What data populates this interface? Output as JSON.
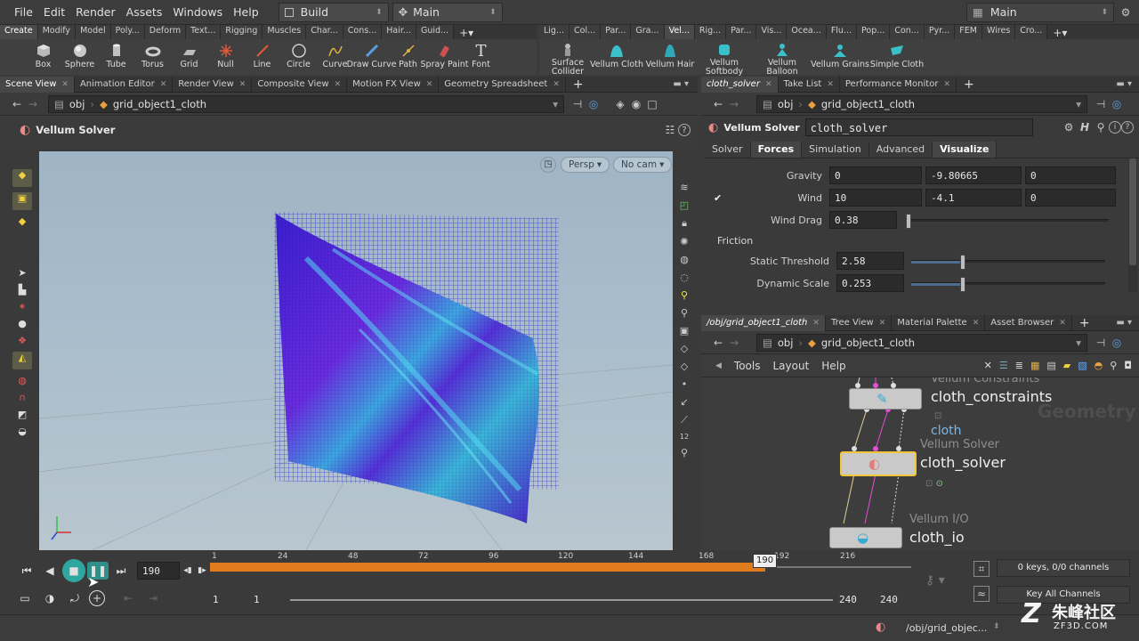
{
  "menubar": {
    "items": [
      "File",
      "Edit",
      "Render",
      "Assets",
      "Windows",
      "Help"
    ],
    "build_label": "Build",
    "desktop_label": "Main",
    "right_desktop_label": "Main"
  },
  "shelf": {
    "tabs_left": [
      "Create",
      "Modify",
      "Model",
      "Poly...",
      "Deform",
      "Text...",
      "Rigging",
      "Muscles",
      "Char...",
      "Cons...",
      "Hair...",
      "Guid..."
    ],
    "tabs_right": [
      "Lig...",
      "Col...",
      "Par...",
      "Gra...",
      "Vel...",
      "Rig...",
      "Par...",
      "Vis...",
      "Ocea...",
      "Flu...",
      "Pop...",
      "Con...",
      "Pyr...",
      "FEM",
      "Wires",
      "Cro..."
    ],
    "tools_left": [
      {
        "label": "Box",
        "icon": "box-icon"
      },
      {
        "label": "Sphere",
        "icon": "sphere-icon"
      },
      {
        "label": "Tube",
        "icon": "tube-icon"
      },
      {
        "label": "Torus",
        "icon": "torus-icon"
      },
      {
        "label": "Grid",
        "icon": "grid-icon"
      },
      {
        "label": "Null",
        "icon": "null-icon"
      },
      {
        "label": "Line",
        "icon": "line-icon"
      },
      {
        "label": "Circle",
        "icon": "circle-icon"
      },
      {
        "label": "Curve",
        "icon": "curve-icon"
      },
      {
        "label": "Draw Curve",
        "icon": "draw-curve-icon"
      },
      {
        "label": "Path",
        "icon": "path-icon"
      },
      {
        "label": "Spray Paint",
        "icon": "spray-paint-icon"
      },
      {
        "label": "Font",
        "icon": "font-icon"
      }
    ],
    "tools_right": [
      {
        "label": "Surface Collider",
        "icon": "surface-collider-icon"
      },
      {
        "label": "Vellum Cloth",
        "icon": "vellum-cloth-icon"
      },
      {
        "label": "Vellum Hair",
        "icon": "vellum-hair-icon"
      },
      {
        "label": "Vellum Softbody",
        "icon": "vellum-softbody-icon"
      },
      {
        "label": "Vellum Balloon",
        "icon": "vellum-balloon-icon"
      },
      {
        "label": "Vellum Grains",
        "icon": "vellum-grains-icon"
      },
      {
        "label": "Simple Cloth",
        "icon": "simple-cloth-icon"
      }
    ]
  },
  "left_pane": {
    "tabs": [
      "Scene View",
      "Animation Editor",
      "Render View",
      "Composite View",
      "Motion FX View",
      "Geometry Spreadsheet"
    ],
    "path_root": "obj",
    "path_node": "grid_object1_cloth",
    "operation": "Vellum Solver",
    "persp_label": "Persp",
    "cam_label": "No cam"
  },
  "params": {
    "tabs": [
      "cloth_solver",
      "Take List",
      "Performance Monitor"
    ],
    "path_root": "obj",
    "path_node": "grid_object1_cloth",
    "node_type": "Vellum Solver",
    "node_name": "cloth_solver",
    "subtabs": [
      "Solver",
      "Forces",
      "Simulation",
      "Advanced",
      "Visualize"
    ],
    "gravity_label": "Gravity",
    "gravity": [
      "0",
      "-9.80665",
      "0"
    ],
    "wind_label": "Wind",
    "wind": [
      "10",
      "-4.1",
      "0"
    ],
    "wind_drag_label": "Wind Drag",
    "wind_drag": "0.38",
    "wind_drag_frac": 0.0,
    "friction_label": "Friction",
    "static_threshold_label": "Static Threshold",
    "static_threshold": "2.58",
    "static_threshold_frac": 0.25,
    "dynamic_scale_label": "Dynamic Scale",
    "dynamic_scale": "0.253",
    "dynamic_scale_frac": 0.25
  },
  "network": {
    "tabs": [
      "/obj/grid_object1_cloth",
      "Tree View",
      "Material Palette",
      "Asset Browser"
    ],
    "path_root": "obj",
    "path_node": "grid_object1_cloth",
    "menu": [
      "Tools",
      "Layout",
      "Help"
    ],
    "watermark": "Geometry",
    "nodes": [
      {
        "type": "Vellum Constraints",
        "name": "cloth_constraints"
      },
      {
        "type": "Vellum Solver",
        "name": "cloth_solver"
      },
      {
        "type": "Vellum I/O",
        "name": "cloth_io"
      }
    ],
    "wire_label": "cloth"
  },
  "timeline": {
    "current_frame": "190",
    "marker_frame": "190",
    "ticks": [
      "1",
      "24",
      "48",
      "72",
      "96",
      "120",
      "144",
      "168",
      "192",
      "216"
    ],
    "range_start": "1",
    "range_start2": "1",
    "range_end": "240",
    "range_end2": "240",
    "keys_info": "0 keys, 0/0 channels",
    "key_all_channels": "Key All Channels",
    "status_path": "/obj/grid_objec..."
  },
  "watermark": {
    "site": "朱峰社区",
    "url": "ZF3D.COM"
  }
}
